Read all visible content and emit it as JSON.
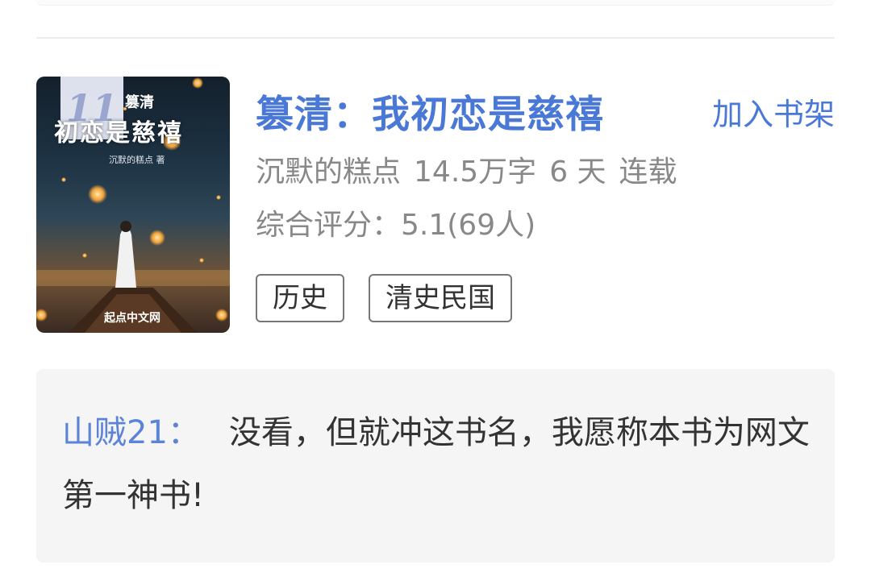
{
  "book": {
    "rank": "11",
    "title": "篡清：我初恋是慈禧",
    "add_to_shelf": "加入书架",
    "author": "沉默的糕点",
    "word_count": "14.5万字",
    "updated": "6 天",
    "status": "连载",
    "rating": "综合评分：5.1(69人)",
    "tags": [
      "历史",
      "清史民国"
    ],
    "cover": {
      "series_text": "篡清",
      "title_text": "初恋是慈禧",
      "author_text": "沉默的糕点 著",
      "site_text": "起点中文网"
    }
  },
  "comment": {
    "user": "山贼21：",
    "text": "没看，但就冲这书名，我愿称本书为网文第一神书!"
  },
  "colors": {
    "accent": "#4a78d6",
    "muted_text": "#888888",
    "comment_bg": "#f5f5f5"
  }
}
